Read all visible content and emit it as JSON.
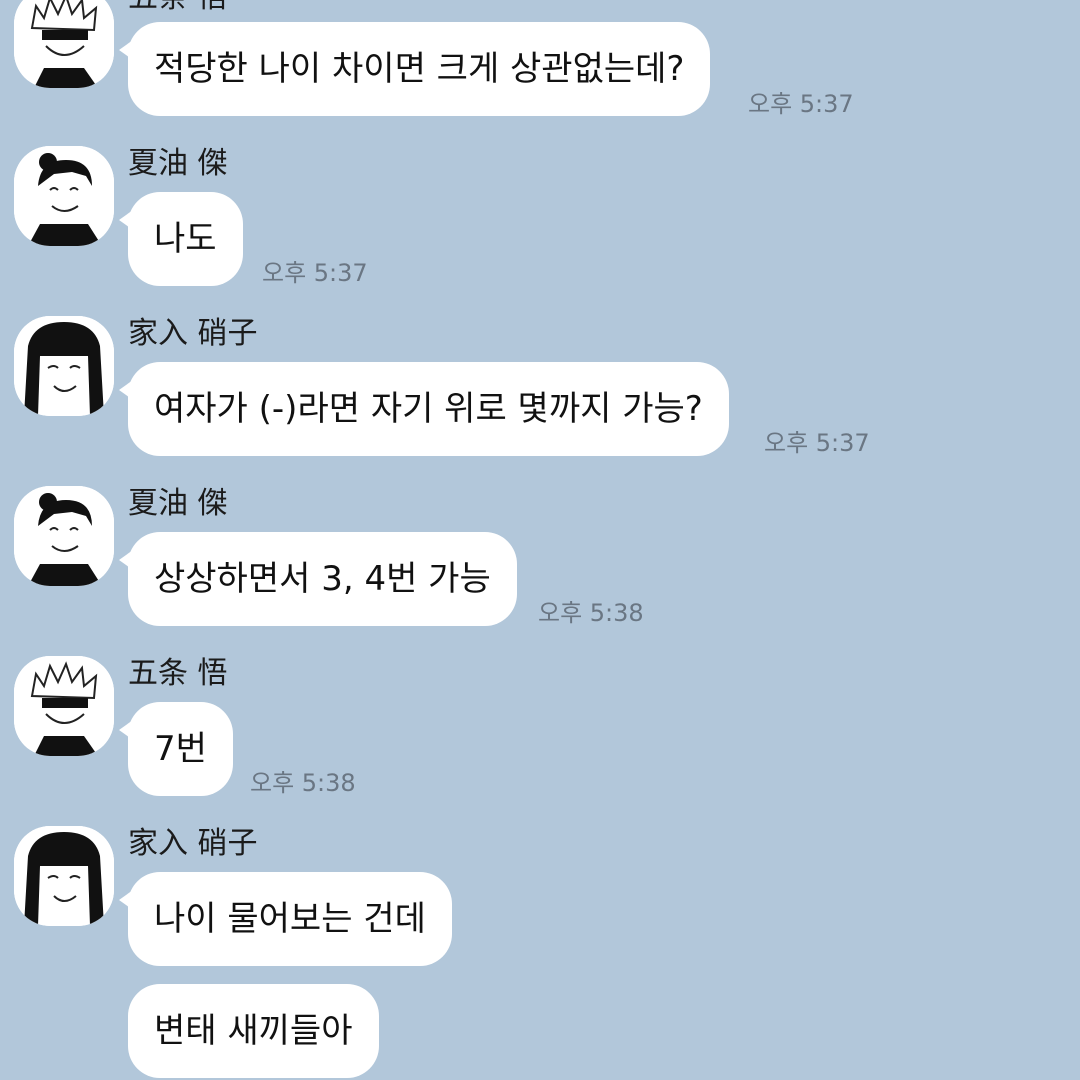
{
  "messages": [
    {
      "sender": "五条 悟",
      "avatar_icon": "gojo-avatar-icon",
      "text": "적당한 나이 차이면 크게 상관없는데?",
      "time": "오후 5:37"
    },
    {
      "sender": "夏油 傑",
      "avatar_icon": "geto-avatar-icon",
      "text": "나도",
      "time": "오후 5:37"
    },
    {
      "sender": "家入 硝子",
      "avatar_icon": "ieiri-avatar-icon",
      "text": "여자가 (-)라면 자기 위로 몇까지 가능?",
      "time": "오후 5:37"
    },
    {
      "sender": "夏油 傑",
      "avatar_icon": "geto-avatar-icon",
      "text": "상상하면서 3, 4번 가능",
      "time": "오후 5:38"
    },
    {
      "sender": "五条 悟",
      "avatar_icon": "gojo-avatar-icon",
      "text": "7번",
      "time": "오후 5:38"
    },
    {
      "sender": "家入 硝子",
      "avatar_icon": "ieiri-avatar-icon",
      "text": "나이 물어보는 건데",
      "time": ""
    },
    {
      "sender": "",
      "avatar_icon": "",
      "text": "변태 새끼들아",
      "time": ""
    }
  ],
  "colors": {
    "background": "#b2c7da",
    "bubble": "#ffffff",
    "time_text": "#6a7683"
  }
}
